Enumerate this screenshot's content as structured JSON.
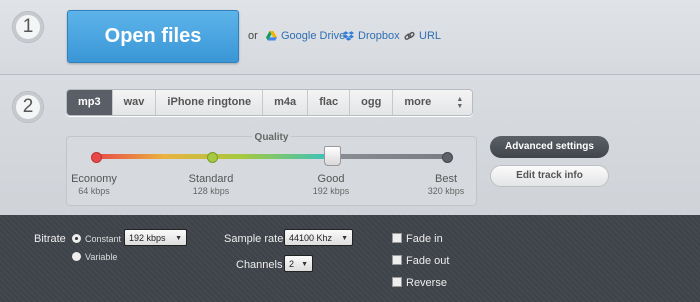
{
  "steps": {
    "one": "1",
    "two": "2"
  },
  "open": {
    "button_label": "Open files",
    "or_text": "or",
    "sources": [
      {
        "label": "Google Drive",
        "icon": "google-drive-icon"
      },
      {
        "label": "Dropbox",
        "icon": "dropbox-icon"
      },
      {
        "label": "URL",
        "icon": "link-icon"
      }
    ]
  },
  "formats": {
    "tabs": [
      "mp3",
      "wav",
      "iPhone ringtone",
      "m4a",
      "flac",
      "ogg",
      "more"
    ],
    "active": "mp3"
  },
  "quality": {
    "title": "Quality",
    "levels": [
      {
        "name": "Economy",
        "kbps": "64 kbps"
      },
      {
        "name": "Standard",
        "kbps": "128 kbps"
      },
      {
        "name": "Good",
        "kbps": "192 kbps"
      },
      {
        "name": "Best",
        "kbps": "320 kbps"
      }
    ],
    "selected_index": 2,
    "colors": {
      "economy": "#e84848",
      "standard": "#a5c93f",
      "good": "#3fc2b5",
      "best": "#6f7379"
    }
  },
  "actions": {
    "advanced": "Advanced settings",
    "edit": "Edit track info"
  },
  "advanced": {
    "bitrate_label": "Bitrate",
    "bitrate_modes": [
      "Constant",
      "Variable"
    ],
    "bitrate_mode_selected": "Constant",
    "bitrate_value": "192 kbps",
    "sample_rate_label": "Sample rate",
    "sample_rate_value": "44100 Khz",
    "channels_label": "Channels",
    "channels_value": "2",
    "options": [
      {
        "label": "Fade in",
        "checked": false
      },
      {
        "label": "Fade out",
        "checked": false
      },
      {
        "label": "Reverse",
        "checked": false
      }
    ]
  }
}
